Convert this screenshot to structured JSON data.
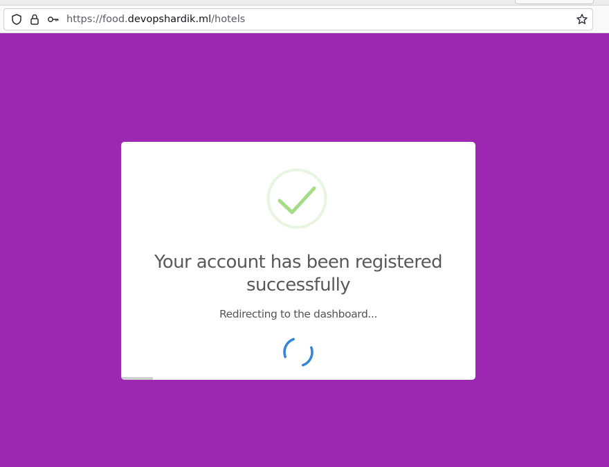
{
  "browser": {
    "url_prefix": "https://food.",
    "url_domain": "devopshardik.ml",
    "url_path": "/hotels",
    "icons": [
      "shield-icon",
      "lock-icon",
      "key-icon",
      "star-icon"
    ]
  },
  "colors": {
    "page_background": "#9c27b0",
    "success_green": "#a5dc86",
    "spinner_blue": "#3085d6"
  },
  "modal": {
    "icon": "success-check-icon",
    "title": "Your account has been registered successfully",
    "subtitle": "Redirecting to the dashboard...",
    "loading_icon": "spinner-icon",
    "timer_progress": 0.09
  }
}
